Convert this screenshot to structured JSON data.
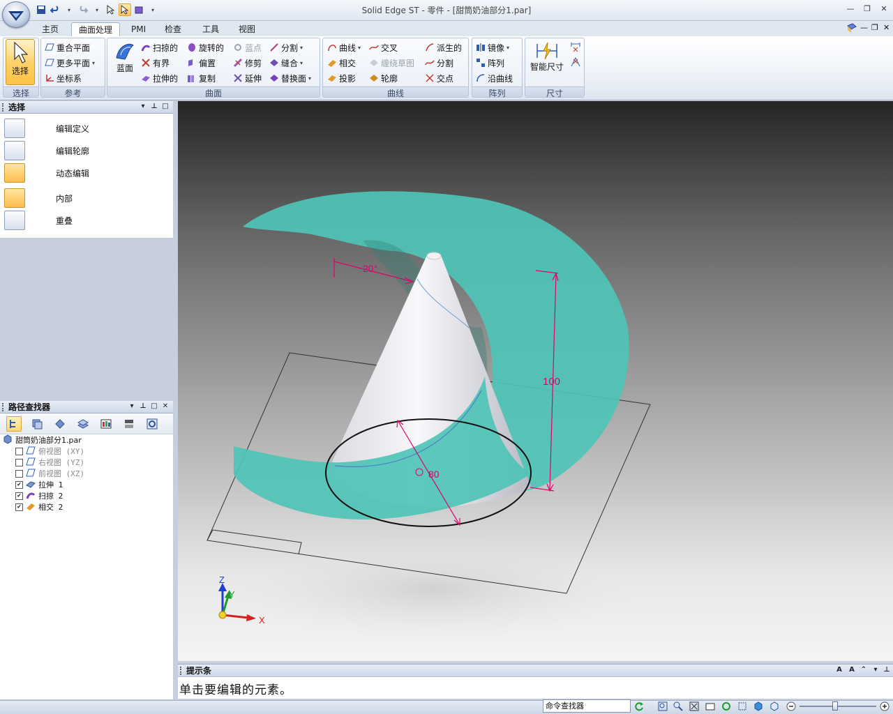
{
  "window": {
    "title": "Solid Edge ST - 零件 - [甜筒奶油部分1.par]"
  },
  "tabs": [
    {
      "label": "主页"
    },
    {
      "label": "曲面处理"
    },
    {
      "label": "PMI"
    },
    {
      "label": "检查"
    },
    {
      "label": "工具"
    },
    {
      "label": "视图"
    }
  ],
  "ribbon": {
    "select": {
      "big_label": "选择",
      "group": "选择"
    },
    "reference": {
      "group": "参考",
      "items": [
        "重合平面",
        "更多平面",
        "坐标系"
      ]
    },
    "surface": {
      "group": "曲面",
      "big_label": "蓝面",
      "items": [
        "扫掠的",
        "旋转的",
        "蓝点",
        "分割",
        "有界",
        "偏置",
        "修剪",
        "缝合",
        "拉伸的",
        "复制",
        "延伸",
        "替换面"
      ]
    },
    "curves": {
      "group": "曲线",
      "items": [
        "曲线",
        "交叉",
        "派生的",
        "相交",
        "缠绕草图",
        "分割",
        "投影",
        "轮廓",
        "交点"
      ]
    },
    "pattern": {
      "group": "阵列",
      "items": [
        "镜像",
        "阵列",
        "沿曲线"
      ]
    },
    "dimension": {
      "group": "尺寸",
      "big_label": "智能尺寸"
    }
  },
  "select_pane": {
    "title": "选择",
    "items": [
      {
        "label": "编辑定义",
        "active": false
      },
      {
        "label": "编辑轮廓",
        "active": false
      },
      {
        "label": "动态编辑",
        "active": true
      },
      {
        "label": "内部",
        "active": true
      },
      {
        "label": "重叠",
        "active": false
      }
    ]
  },
  "pathfinder": {
    "title": "路径查找器",
    "root": "甜筒奶油部分1.par",
    "nodes": [
      {
        "label": "俯视图 (XY)",
        "checked": false,
        "dim": true
      },
      {
        "label": "右视图 (YZ)",
        "checked": false,
        "dim": true
      },
      {
        "label": "前视图 (XZ)",
        "checked": false,
        "dim": true
      },
      {
        "label": "拉伸 1",
        "checked": true,
        "dim": false
      },
      {
        "label": "扫掠 2",
        "checked": true,
        "dim": false
      },
      {
        "label": "相交 2",
        "checked": true,
        "dim": false
      }
    ]
  },
  "viewport": {
    "dims": {
      "angle": "20°",
      "height": "100",
      "diameter": "80"
    },
    "axes": {
      "x": "X",
      "y": "Y",
      "z": "Z"
    },
    "colors": {
      "surface": "#4fc4b6",
      "dimension": "#e0006a"
    }
  },
  "prompt_bar": {
    "title": "提示条",
    "message": "单击要编辑的元素。"
  },
  "status_bar": {
    "command_finder": "命令查找器"
  }
}
